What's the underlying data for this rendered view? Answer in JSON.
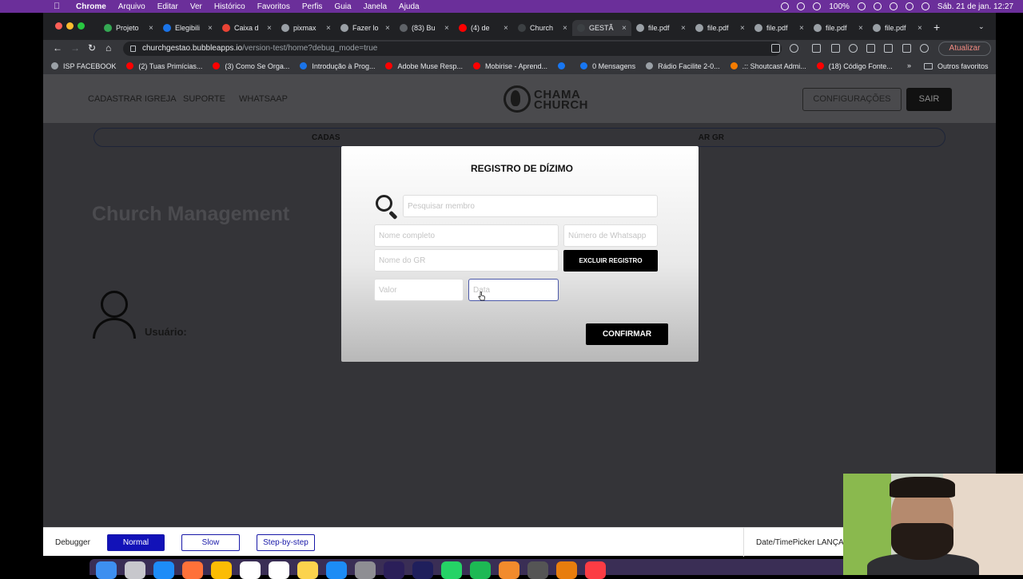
{
  "menubar": {
    "app_name": "Chrome",
    "items": [
      "Arquivo",
      "Editar",
      "Ver",
      "Histórico",
      "Favoritos",
      "Perfis",
      "Guia",
      "Janela",
      "Ajuda"
    ],
    "battery": "100%",
    "datetime": "Sáb. 21 de jan.  12:27"
  },
  "browser": {
    "tabs": [
      {
        "label": "Projeto",
        "color": "#34a853"
      },
      {
        "label": "Elegibili",
        "color": "#1a73e8"
      },
      {
        "label": "Caixa d",
        "color": "#ea4335"
      },
      {
        "label": "pixmax",
        "color": "#9aa0a6"
      },
      {
        "label": "Fazer lo",
        "color": "#9aa0a6"
      },
      {
        "label": "(83) Bu",
        "color": "#5f6368"
      },
      {
        "label": "(4) de",
        "color": "#ff0000"
      },
      {
        "label": "Church",
        "color": "#3c4043"
      },
      {
        "label": "GESTÃ",
        "color": "#3c4043"
      },
      {
        "label": "file.pdf",
        "color": "#9aa0a6"
      },
      {
        "label": "file.pdf",
        "color": "#9aa0a6"
      },
      {
        "label": "file.pdf",
        "color": "#9aa0a6"
      },
      {
        "label": "file.pdf",
        "color": "#9aa0a6"
      },
      {
        "label": "file.pdf",
        "color": "#9aa0a6"
      }
    ],
    "active_tab_index": 8,
    "url_host": "churchgestao.bubbleapps.io",
    "url_path": "/version-test/home?debug_mode=true",
    "update_label": "Atualizar",
    "bookmarks": [
      {
        "label": "ISP FACEBOOK",
        "color": "#9aa0a6"
      },
      {
        "label": "(2) Tuas Primícias...",
        "color": "#ff0000"
      },
      {
        "label": "(3) Como Se Orga...",
        "color": "#ff0000"
      },
      {
        "label": "Introdução à Prog...",
        "color": "#1a73e8"
      },
      {
        "label": "Adobe Muse Resp...",
        "color": "#ff0000"
      },
      {
        "label": "Mobirise - Aprend...",
        "color": "#ff0000"
      },
      {
        "label": "",
        "color": "#1877f2"
      },
      {
        "label": "0 Mensagens",
        "color": "#1877f2"
      },
      {
        "label": "Rádio Facilite 2-0...",
        "color": "#9aa0a6"
      },
      {
        "label": ".:: Shoutcast Admi...",
        "color": "#f57c00"
      },
      {
        "label": "(18) Código Fonte...",
        "color": "#ff0000"
      }
    ],
    "bookmarks_more": "»",
    "other_bookmarks": "Outros favoritos"
  },
  "app": {
    "nav": [
      "CADASTRAR IGREJA",
      "SUPORTE",
      "WHATSAAP"
    ],
    "logo_line1": "CHAMA",
    "logo_line2": "CHURCH",
    "config_label": "CONFIGURAÇÕES",
    "logout_label": "SAIR",
    "subbar_left": "CADAS",
    "subbar_right": "AR GR",
    "title": "Church Management",
    "user_label": "Usuário:"
  },
  "modal": {
    "title": "REGISTRO DE DÍZIMO",
    "search_placeholder": "Pesquisar membro",
    "name_placeholder": "Nome completo",
    "whatsapp_placeholder": "Número de Whatsapp",
    "gr_placeholder": "Nome do GR",
    "delete_label": "EXCLUIR REGISTRO",
    "value_placeholder": "Valor",
    "date_placeholder": "Data",
    "confirm_label": "CONFIRMAR"
  },
  "debugger": {
    "label": "Debugger",
    "modes": [
      "Normal",
      "Slow",
      "Step-by-step"
    ],
    "active_mode": "Normal",
    "inspect_text": "Date/TimePicker LANÇA"
  },
  "dock": {
    "apps": [
      "finder",
      "launchpad",
      "safari",
      "firefox",
      "chrome",
      "calendar",
      "reminders",
      "notes",
      "app-store",
      "system-preferences",
      "premiere",
      "after-effects",
      "whatsapp",
      "spotify",
      "books",
      "calculator",
      "blender",
      "music"
    ]
  }
}
